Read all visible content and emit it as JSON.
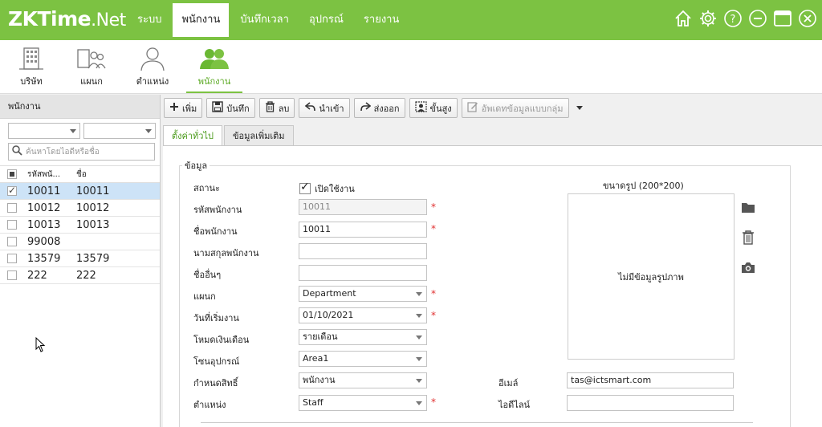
{
  "app": {
    "logo_main": "ZKTime",
    "logo_suffix": ".Net"
  },
  "menu": [
    {
      "label": "ระบบ",
      "active": false
    },
    {
      "label": "พนักงาน",
      "active": true
    },
    {
      "label": "บันทึกเวลา",
      "active": false
    },
    {
      "label": "อุปกรณ์",
      "active": false
    },
    {
      "label": "รายงาน",
      "active": false
    }
  ],
  "top_icons": [
    "home-icon",
    "gear-icon",
    "help-icon",
    "minimize-icon",
    "maximize-icon",
    "close-icon"
  ],
  "subnav": [
    {
      "label": "บริษัท",
      "icon": "building-icon"
    },
    {
      "label": "แผนก",
      "icon": "department-icon"
    },
    {
      "label": "ตำแหน่ง",
      "icon": "position-icon"
    },
    {
      "label": "พนักงาน",
      "icon": "employees-icon",
      "active": true
    }
  ],
  "left_panel": {
    "title": "พนักงาน",
    "search_placeholder": "ค้นหาโดยไอดีหรือชื่อ",
    "columns": [
      "รหัสพนั...",
      "ชื่อ"
    ],
    "rows": [
      {
        "id": "10011",
        "name": "10011",
        "checked": true,
        "selected": true
      },
      {
        "id": "10012",
        "name": "10012",
        "checked": false,
        "selected": false
      },
      {
        "id": "10013",
        "name": "10013",
        "checked": false,
        "selected": false
      },
      {
        "id": "99008",
        "name": "",
        "checked": false,
        "selected": false
      },
      {
        "id": "13579",
        "name": "13579",
        "checked": false,
        "selected": false
      },
      {
        "id": "222",
        "name": "222",
        "checked": false,
        "selected": false
      }
    ]
  },
  "toolbar": {
    "add": "เพิ่ม",
    "save": "บันทึก",
    "delete": "ลบ",
    "import": "นำเข้า",
    "export": "ส่งออก",
    "advanced": "ขั้นสูง",
    "batch_update": "อัพเดทข้อมูลแบบกลุ่ม"
  },
  "tabs": {
    "general": "ตั้งค่าทั่วไป",
    "extra": "ข้อมูลเพิ่มเติม"
  },
  "form": {
    "legend": "ข้อมูล",
    "status_label": "สถานะ",
    "enable_label": "เปิดใช้งาน",
    "emp_id_label": "รหัสพนักงาน",
    "emp_id_value": "10011",
    "emp_name_label": "ชื่อพนักงาน",
    "emp_name_value": "10011",
    "surname_label": "นามสกุลพนักงาน",
    "surname_value": "",
    "other_name_label": "ชื่ออื่นๆ",
    "other_name_value": "",
    "department_label": "แผนก",
    "department_value": "Department",
    "start_date_label": "วันที่เริ่มงาน",
    "start_date_value": "01/10/2021",
    "salary_mode_label": "โหมดเงินเดือน",
    "salary_mode_value": "รายเดือน",
    "device_zone_label": "โซนอุปกรณ์",
    "device_zone_value": "Area1",
    "permission_label": "กำหนดสิทธิ์",
    "permission_value": "พนักงาน",
    "position_label": "ตำแหน่ง",
    "position_value": "Staff",
    "email_label": "อีเมล์",
    "email_value": "tas@ictsmart.com",
    "line_id_label": "ไอดีไลน์",
    "line_id_value": "",
    "required_mark": "*",
    "photo_size_label": "ขนาดรูป (200*200)",
    "no_photo_text": "ไม่มีข้อมูลรูปภาพ"
  },
  "colors": {
    "brand": "#7cc242",
    "active_text": "#4a9a1a",
    "required": "#e03030",
    "selected_row": "#cde3f7"
  }
}
